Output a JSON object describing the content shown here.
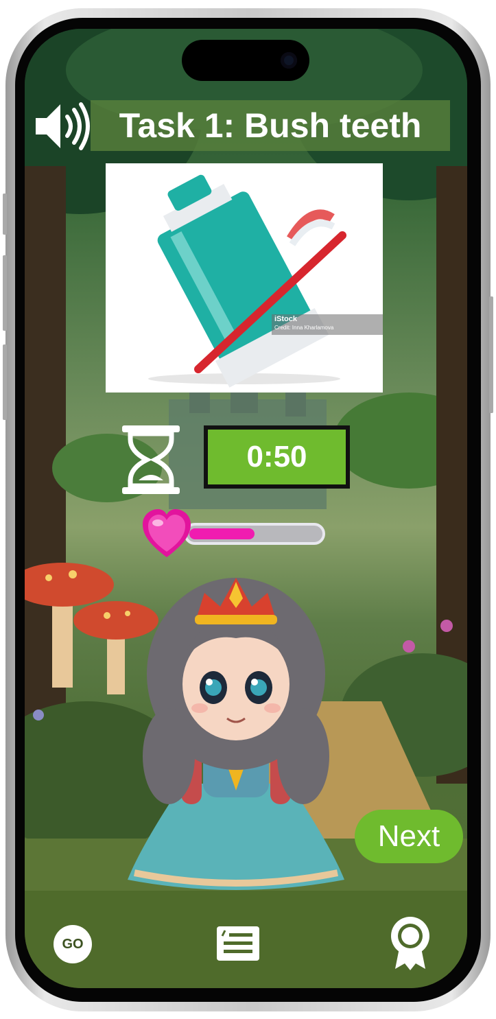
{
  "header": {
    "title": "Task 1: Bush teeth",
    "sound_icon": "speaker-volume-icon"
  },
  "task_image": {
    "subject": "toothpaste-and-toothbrush",
    "watermark_brand": "iStock",
    "watermark_credit": "Credit: Inna Kharlamova"
  },
  "timer": {
    "icon": "hourglass-icon",
    "value": "0:50"
  },
  "health": {
    "icon": "heart-icon",
    "level": 0.5
  },
  "character": {
    "name_icon": "princess-character"
  },
  "actions": {
    "next_label": "Next"
  },
  "bottom_nav": {
    "go_label": "GO",
    "tasks_icon": "task-list-icon",
    "badge_icon": "award-badge-icon"
  },
  "colors": {
    "accent_green": "#6fbb2e",
    "progress_pink": "#f01cb0",
    "nav_bar": "#4f6b2b"
  }
}
